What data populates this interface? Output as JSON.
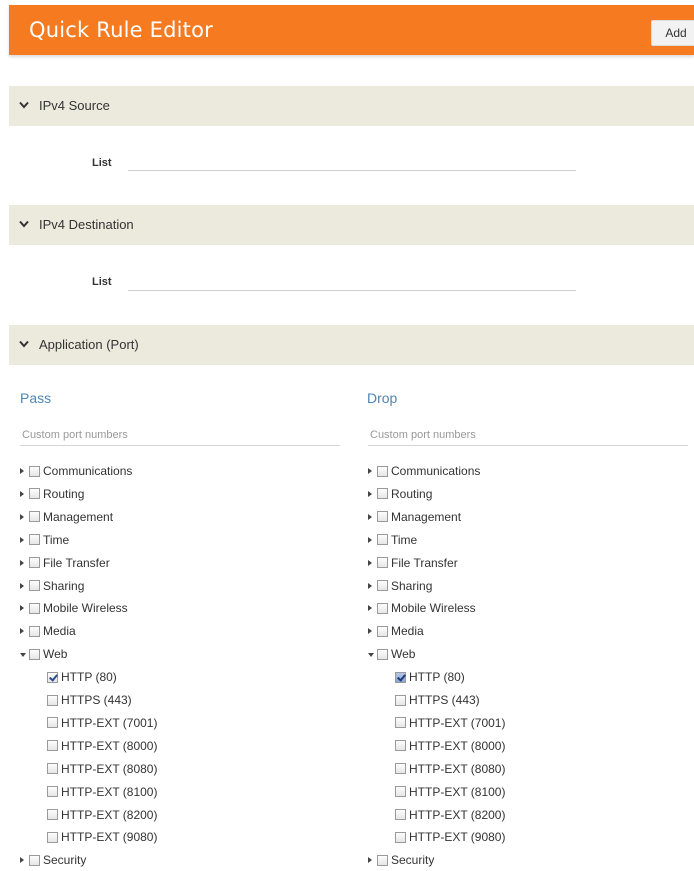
{
  "header": {
    "title": "Quick Rule Editor",
    "add_label": "Add"
  },
  "sections": {
    "ipv4_source": {
      "label": "IPv4 Source",
      "list_label": "List"
    },
    "ipv4_destination": {
      "label": "IPv4 Destination",
      "list_label": "List"
    },
    "application": {
      "label": "Application (Port)"
    }
  },
  "pass": {
    "title": "Pass",
    "placeholder": "Custom port numbers",
    "categories": [
      "Communications",
      "Routing",
      "Management",
      "Time",
      "File Transfer",
      "Sharing",
      "Mobile Wireless",
      "Media",
      "Web",
      "Security"
    ],
    "web_items": [
      "HTTP (80)",
      "HTTPS (443)",
      "HTTP-EXT (7001)",
      "HTTP-EXT (8000)",
      "HTTP-EXT (8080)",
      "HTTP-EXT (8100)",
      "HTTP-EXT (8200)",
      "HTTP-EXT (9080)"
    ]
  },
  "drop": {
    "title": "Drop",
    "placeholder": "Custom port numbers",
    "categories": [
      "Communications",
      "Routing",
      "Management",
      "Time",
      "File Transfer",
      "Sharing",
      "Mobile Wireless",
      "Media",
      "Web",
      "Security"
    ],
    "web_items": [
      "HTTP (80)",
      "HTTPS (443)",
      "HTTP-EXT (7001)",
      "HTTP-EXT (8000)",
      "HTTP-EXT (8080)",
      "HTTP-EXT (8100)",
      "HTTP-EXT (8200)",
      "HTTP-EXT (9080)"
    ]
  },
  "colors": {
    "header": "#f57a20",
    "section_bar": "#ece9dd",
    "column_title": "#4e86b5"
  },
  "checked": {
    "pass": [
      "HTTP (80)"
    ],
    "drop": [
      "HTTP (80)"
    ]
  },
  "expanded": [
    "Web"
  ]
}
